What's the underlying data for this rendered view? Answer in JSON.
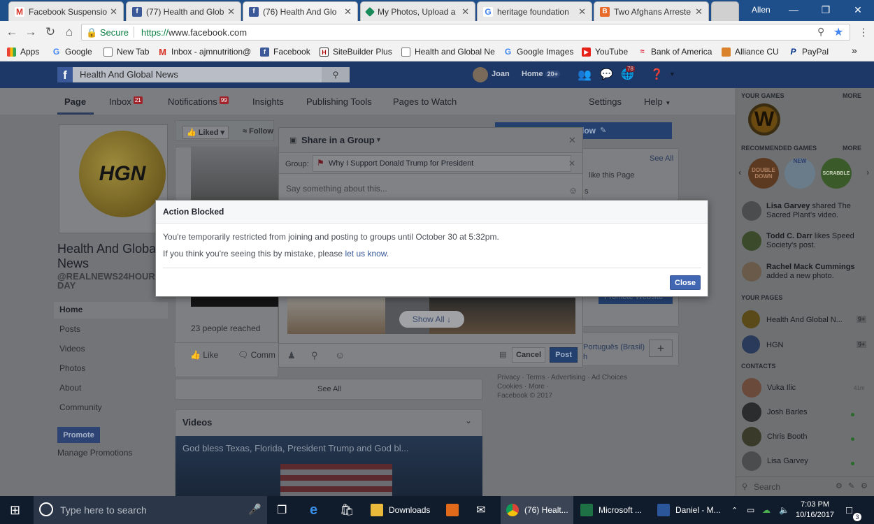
{
  "browser": {
    "tabs": [
      {
        "title": "Facebook Suspensio",
        "icon": "gmail-icon"
      },
      {
        "title": "(77) Health and Glob",
        "icon": "facebook-icon"
      },
      {
        "title": "(76) Health And Glo",
        "icon": "facebook-icon"
      },
      {
        "title": "My Photos, Upload a",
        "icon": "photos-icon"
      },
      {
        "title": "heritage foundation",
        "icon": "google-icon"
      },
      {
        "title": "Two Afghans Arreste",
        "icon": "news-icon"
      }
    ],
    "user": "Allen",
    "secure_label": "Secure",
    "url_proto": "https://",
    "url_rest": "www.facebook.com",
    "bookmarks": [
      "Apps",
      "Google",
      "New Tab",
      "Inbox - ajmnutrition@",
      "Facebook",
      "SiteBuilder Plus",
      "Health and Global Ne",
      "Google Images",
      "YouTube",
      "Bank of America",
      "Alliance CU",
      "PayPal"
    ],
    "more_bookmarks": "»"
  },
  "fb": {
    "search_value": "Health And Global News",
    "user_name": "Joan",
    "home_label": "Home",
    "home_count": "20+",
    "notif_count": "78",
    "page_tabs": {
      "page": "Page",
      "inbox": "Inbox",
      "inbox_count": "21",
      "notifications": "Notifications",
      "notif_count": "99",
      "insights": "Insights",
      "publishing": "Publishing Tools",
      "watch": "Pages to Watch",
      "settings": "Settings",
      "help": "Help"
    },
    "page_name_1": "Health And Globa",
    "page_name_2": "News",
    "page_handle_1": "@REALNEWS24HOURS",
    "page_handle_2": "DAY",
    "logo_text": "HGN",
    "left_nav": [
      "Home",
      "Posts",
      "Videos",
      "Photos",
      "About",
      "Community"
    ],
    "promote": "Promote",
    "manage_promotions": "Manage Promotions",
    "liked": "Liked",
    "follow": "Follow",
    "follow_btn": "low",
    "people_reached": "23 people reached",
    "like": "Like",
    "comment": "Comm",
    "see_all": "See All",
    "videos_heading": "Videos",
    "video_caption": "God bless Texas, Florida, President Trump and God bl...",
    "right_col": {
      "see_all": "See All",
      "likes": "like this Page",
      "s": "s",
      "lang": "Português (Brasil)",
      "lang2": "h",
      "footer1": "Privacy · Terms · Advertising · Ad Choices",
      "footer2": "Cookies · More ·",
      "footer3": "Facebook © 2017",
      "promote_btn": "Promote Website"
    }
  },
  "share": {
    "title": "Share in a Group",
    "group_label": "Group:",
    "group_value": "Why I Support Donald Trump for President",
    "placeholder": "Say something about this...",
    "show_all": "Show All ↓",
    "cancel": "Cancel",
    "post": "Post"
  },
  "modal": {
    "title": "Action Blocked",
    "line1": "You're temporarily restricted from joining and posting to groups until October 30 at 5:32pm.",
    "line2_pre": "If you think you're seeing this by mistake, please ",
    "line2_link": "let us know",
    "line2_post": ".",
    "close": "Close"
  },
  "sidebar": {
    "your_games": "YOUR GAMES",
    "more": "MORE",
    "recommended": "RECOMMENDED GAMES",
    "game_labels": [
      "DOUBLE DOWN",
      "NEW",
      "SCRABBLE"
    ],
    "activity": [
      {
        "name": "Lisa Garvey",
        "text1": " shared The",
        "text2": "Sacred Plant's video."
      },
      {
        "name": "Todd C. Darr",
        "text1": " likes Speed",
        "text2": "Society's post."
      },
      {
        "name": "Rachel Mack Cummings",
        "text1": "",
        "text2": "added a new photo."
      }
    ],
    "your_pages": "YOUR PAGES",
    "pages": [
      {
        "name": "Health And Global N...",
        "count": "9+"
      },
      {
        "name": "HGN",
        "count": "9+"
      }
    ],
    "contacts_heading": "CONTACTS",
    "contacts": [
      {
        "name": "Vuka Ilic",
        "status": "41m"
      },
      {
        "name": "Josh Barles",
        "status": ""
      },
      {
        "name": "Chris Booth",
        "status": ""
      },
      {
        "name": "Lisa Garvey",
        "status": ""
      }
    ],
    "search_placeholder": "Search"
  },
  "taskbar": {
    "search_placeholder": "Type here to search",
    "apps": [
      {
        "label": "Downloads",
        "icon": "folder-icon"
      },
      {
        "label": "(76) Healt...",
        "icon": "chrome-icon"
      },
      {
        "label": "Microsoft ...",
        "icon": "excel-icon"
      },
      {
        "label": "Daniel - M...",
        "icon": "word-icon"
      }
    ],
    "time": "7:03 PM",
    "date": "10/16/2017",
    "notif_count": "3"
  }
}
